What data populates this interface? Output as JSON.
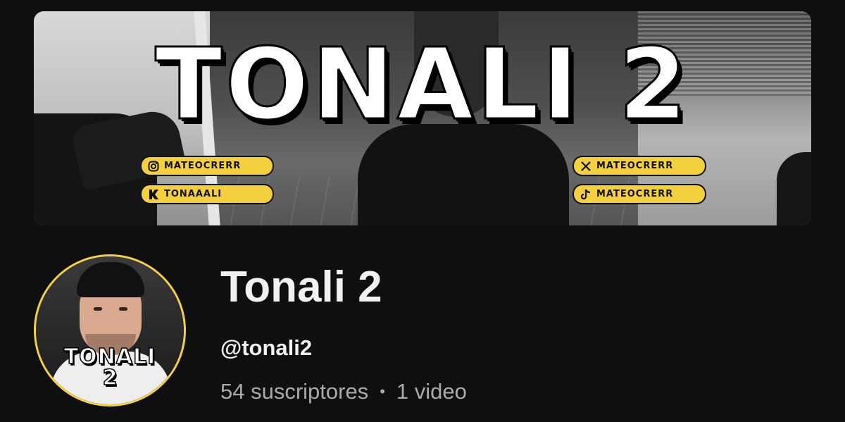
{
  "banner": {
    "title": "TONALI 2",
    "socials": [
      {
        "platform": "instagram",
        "icon": "instagram-icon",
        "handle": "MATEOCRERR"
      },
      {
        "platform": "kick",
        "icon": "kick-icon",
        "handle": "TONAAALI"
      },
      {
        "platform": "x",
        "icon": "x-icon",
        "handle": "MATEOCRERR"
      },
      {
        "platform": "tiktok",
        "icon": "tiktok-icon",
        "handle": "MATEOCRERR"
      }
    ],
    "pill_color": "#f4d03f"
  },
  "avatar": {
    "text_line1": "TONALI",
    "text_line2": "2",
    "ring_color": "#f5d04a"
  },
  "channel": {
    "name": "Tonali 2",
    "handle": "@tonali2",
    "subscribers": "54 suscriptores",
    "separator": "•",
    "videos": "1 video"
  },
  "colors": {
    "background": "#0f0f0f",
    "primary_text": "#f1f1f1",
    "secondary_text": "#aaaaaa"
  }
}
